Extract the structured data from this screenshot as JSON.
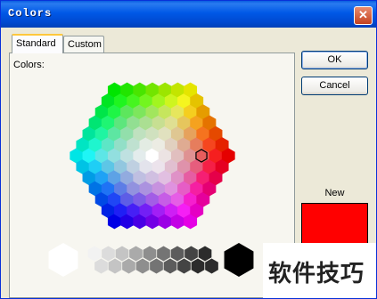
{
  "window": {
    "title": "Colors",
    "close_icon": "close-icon"
  },
  "tabs": [
    {
      "label": "Standard",
      "selected": true
    },
    {
      "label": "Custom",
      "selected": false
    }
  ],
  "colors_label": "Colors:",
  "buttons": {
    "ok": "OK",
    "cancel": "Cancel"
  },
  "new_label": "New",
  "new_color": "#ff0000",
  "watermark": "软件技巧"
}
